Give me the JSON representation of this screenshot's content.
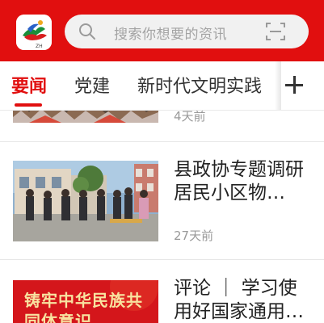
{
  "search": {
    "placeholder": "搜索你想要的资讯"
  },
  "tabs": [
    {
      "label": "要闻",
      "active": true
    },
    {
      "label": "党建",
      "active": false
    },
    {
      "label": "新时代文明实践",
      "active": false
    }
  ],
  "colors": {
    "brand_red": "#e10f0f",
    "active_tab": "#e10f0f",
    "muted_text": "#9a9a9a"
  },
  "icons": {
    "search": "search-icon",
    "scan": "scan-icon",
    "add_channel": "plus-icon"
  },
  "news": [
    {
      "title": "",
      "time": "4天前"
    },
    {
      "title": "县政协专题调研居民小区物…",
      "time": "27天前"
    },
    {
      "title": "评论 ｜ 学习使用好国家通用…",
      "time": ""
    }
  ],
  "thumb3_text": "铸牢中华民族共同体意识"
}
